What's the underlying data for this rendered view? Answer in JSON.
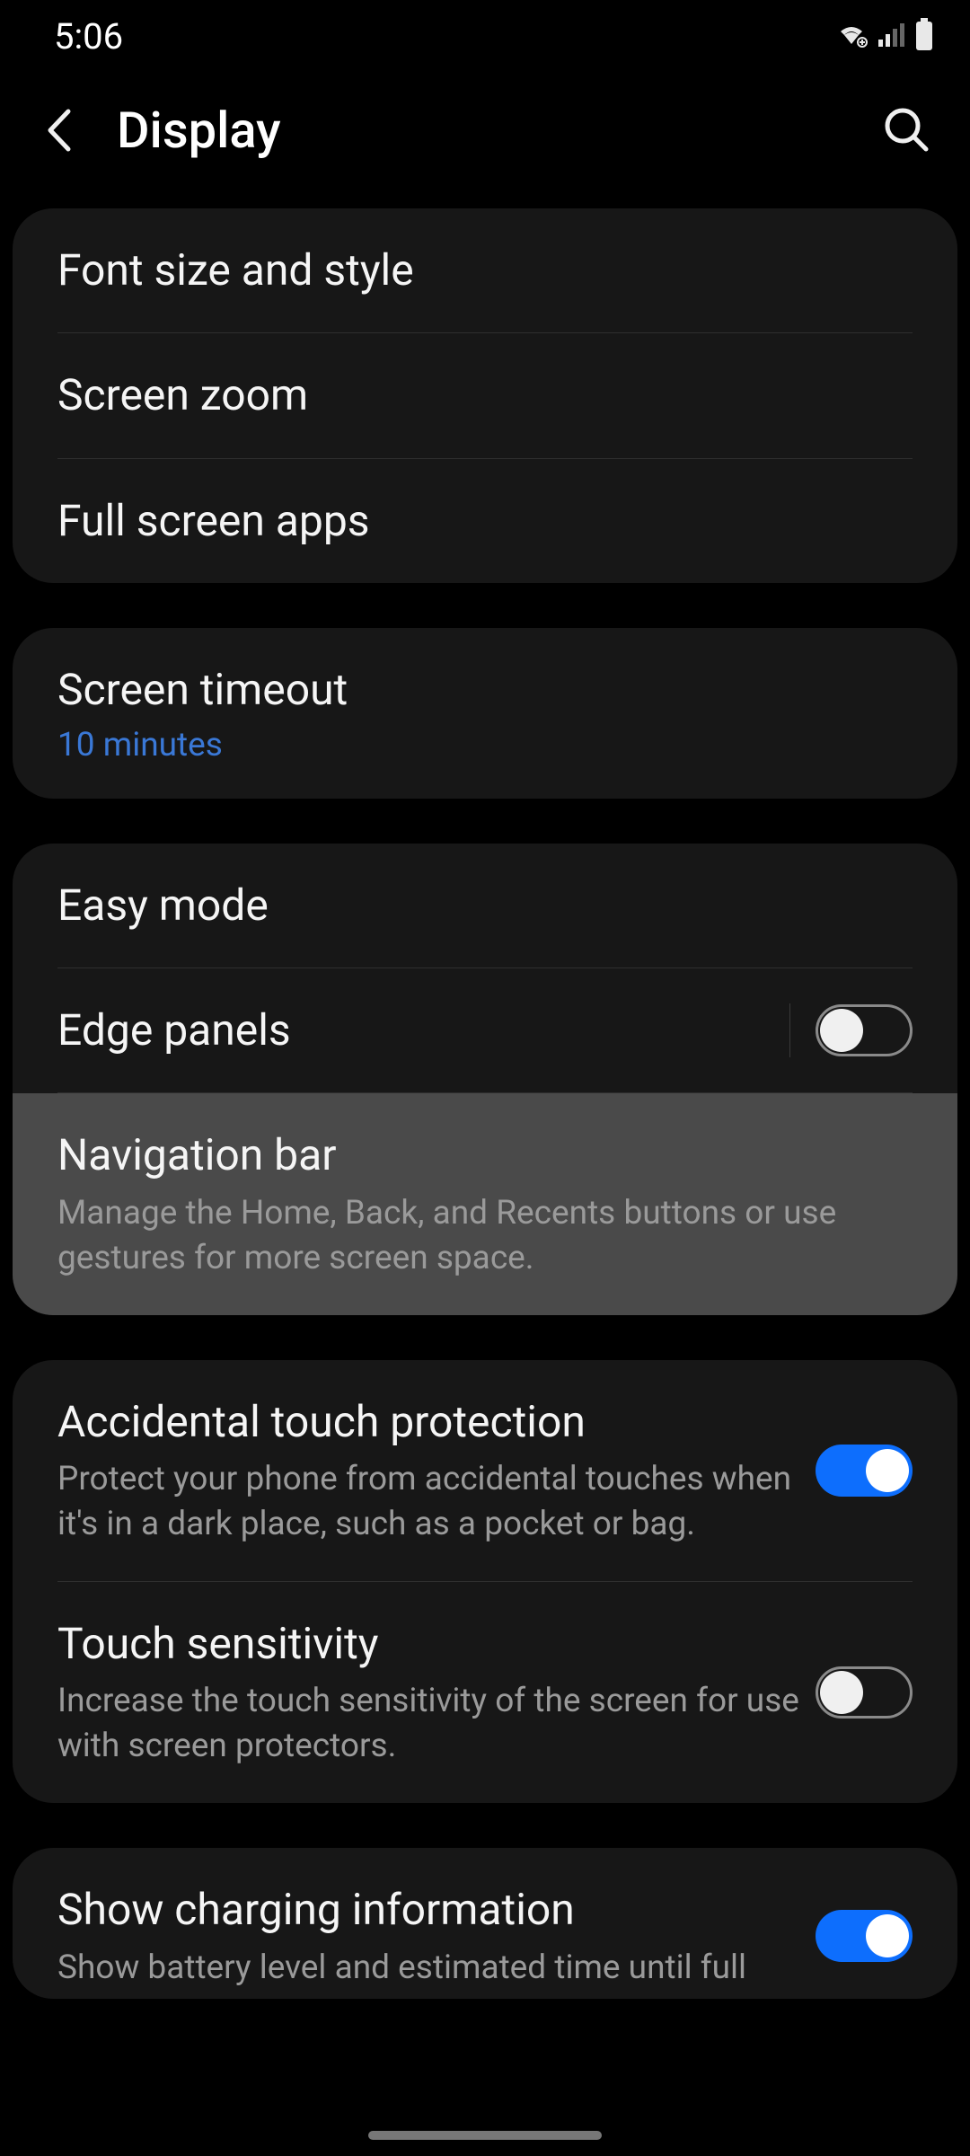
{
  "status": {
    "time": "5:06"
  },
  "header": {
    "title": "Display"
  },
  "group1": {
    "font_size_style": "Font size and style",
    "screen_zoom": "Screen zoom",
    "full_screen_apps": "Full screen apps"
  },
  "group2": {
    "screen_timeout": {
      "title": "Screen timeout",
      "value": "10 minutes"
    }
  },
  "group3": {
    "easy_mode": "Easy mode",
    "edge_panels": "Edge panels",
    "navigation_bar": {
      "title": "Navigation bar",
      "desc": "Manage the Home, Back, and Recents buttons or use gestures for more screen space."
    }
  },
  "group4": {
    "accidental_touch": {
      "title": "Accidental touch protection",
      "desc": "Protect your phone from accidental touches when it's in a dark place, such as a pocket or bag."
    },
    "touch_sensitivity": {
      "title": "Touch sensitivity",
      "desc": "Increase the touch sensitivity of the screen for use with screen protectors."
    }
  },
  "group5": {
    "charging_info": {
      "title": "Show charging information",
      "desc": "Show battery level and estimated time until full"
    }
  },
  "toggles": {
    "edge_panels": false,
    "accidental_touch": true,
    "touch_sensitivity": false,
    "charging_info": true
  }
}
